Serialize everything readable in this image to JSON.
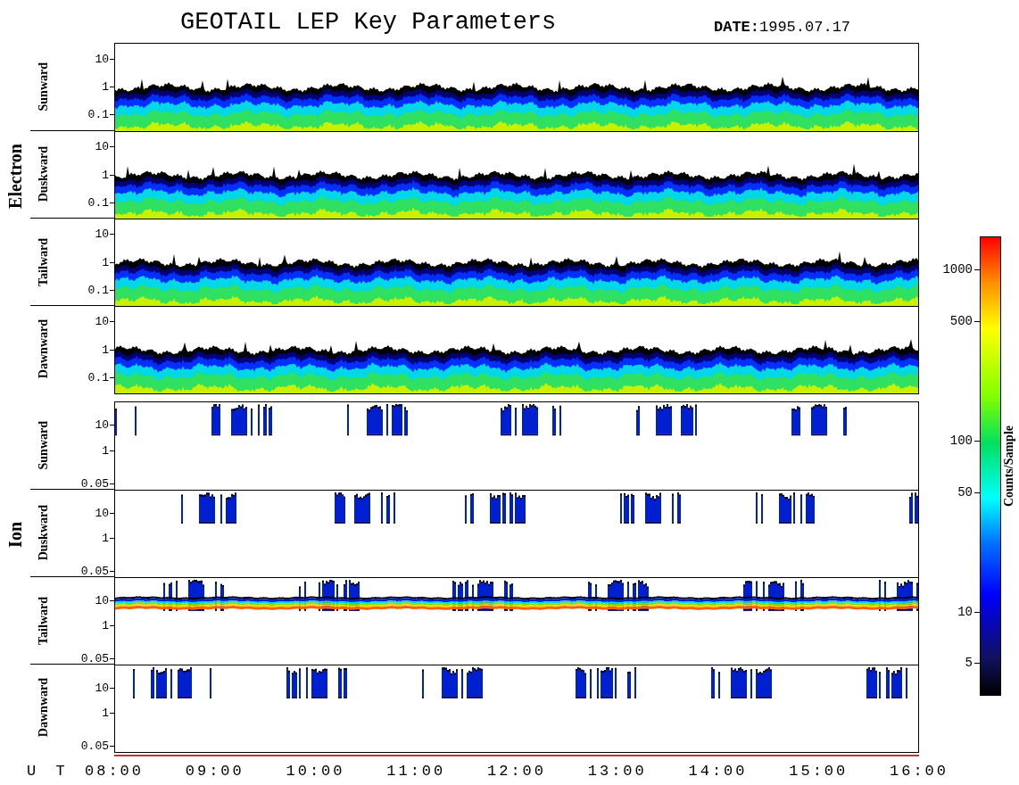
{
  "title": "GEOTAIL LEP Key Parameters",
  "date": {
    "label": "DATE:",
    "value": "1995.07.17"
  },
  "groups": [
    {
      "label": "Electron",
      "panels": [
        {
          "label": "Sunward",
          "kind": "continuous",
          "yticks": [
            "10",
            "1",
            "0.1"
          ]
        },
        {
          "label": "Duskward",
          "kind": "continuous",
          "yticks": [
            "10",
            "1",
            "0.1"
          ]
        },
        {
          "label": "Tailward",
          "kind": "continuous",
          "yticks": [
            "10",
            "1",
            "0.1"
          ]
        },
        {
          "label": "Dawnward",
          "kind": "continuous",
          "yticks": [
            "10",
            "1",
            "0.1"
          ]
        }
      ]
    },
    {
      "label": "Ion",
      "panels": [
        {
          "label": "Sunward",
          "kind": "patchy",
          "yticks": [
            "10",
            "1",
            "0.05"
          ]
        },
        {
          "label": "Duskward",
          "kind": "patchy",
          "yticks": [
            "10",
            "1",
            "0.05"
          ]
        },
        {
          "label": "Tailward",
          "kind": "band",
          "yticks": [
            "10",
            "1",
            "0.05"
          ]
        },
        {
          "label": "Dawnward",
          "kind": "patchy",
          "yticks": [
            "10",
            "1",
            "0.05"
          ]
        }
      ]
    }
  ],
  "x_axis": {
    "label": "U T",
    "ticks": [
      "08:00",
      "09:00",
      "10:00",
      "11:00",
      "12:00",
      "13:00",
      "14:00",
      "15:00",
      "16:00"
    ]
  },
  "colorbar": {
    "label": "Counts/Sample",
    "ticks": [
      "1000",
      "500",
      "100",
      "50",
      "10",
      "5"
    ]
  }
}
